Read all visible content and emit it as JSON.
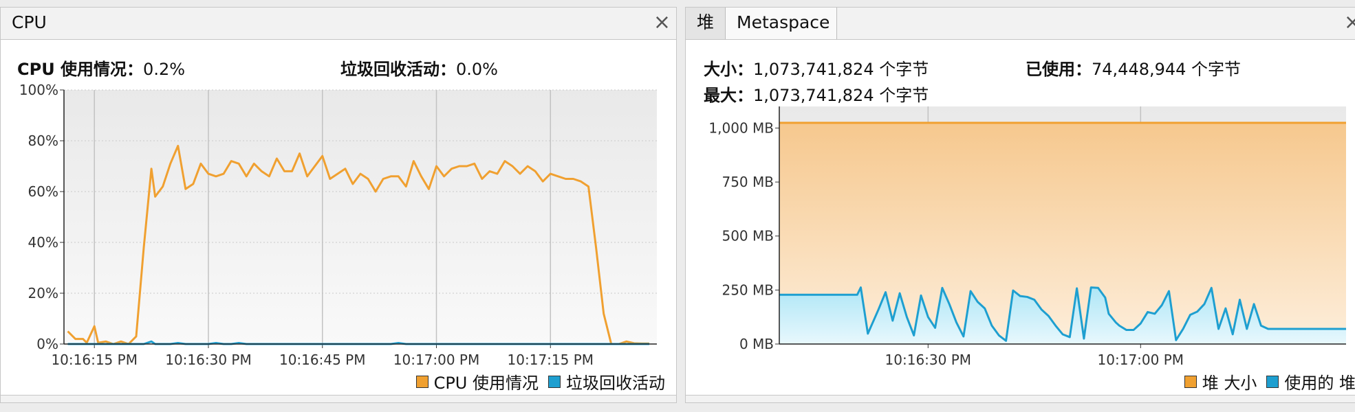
{
  "cpu_panel": {
    "tab_label": "CPU",
    "close_glyph": "×",
    "stats": {
      "cpu_label": "CPU 使用情况：",
      "cpu_value": "0.2%",
      "gc_label": "垃圾回收活动：",
      "gc_value": "0.0%"
    },
    "legend": {
      "cpu": "CPU 使用情况",
      "gc": "垃圾回收活动"
    }
  },
  "heap_panel": {
    "tabs": [
      "堆",
      "Metaspace"
    ],
    "close_glyph": "×",
    "stats": {
      "size_label": "大小：",
      "size_value": "1,073,741,824 个字节",
      "used_label": "已使用：",
      "used_value": "74,448,944 个字节",
      "max_label": "最大：",
      "max_value": "1,073,741,824 个字节"
    },
    "legend": {
      "size": "堆 大小",
      "used": "使用的 堆"
    }
  },
  "colors": {
    "orange": "#f0a030",
    "blue": "#1e9fd0"
  },
  "chart_data": [
    {
      "type": "line",
      "title": "CPU",
      "x": [
        "10:16:11.5",
        "10:16:12.5",
        "10:16:13.5",
        "10:16:14",
        "10:16:15",
        "10:16:15.5",
        "10:16:16.5",
        "10:16:17.5",
        "10:16:18.5",
        "10:16:19.5",
        "10:16:20.5",
        "10:16:21.5",
        "10:16:22.5",
        "10:16:23",
        "10:16:24",
        "10:16:25",
        "10:16:26",
        "10:16:27",
        "10:16:28",
        "10:16:29",
        "10:16:30",
        "10:16:31",
        "10:16:32",
        "10:16:33",
        "10:16:34",
        "10:16:35",
        "10:16:36",
        "10:16:37",
        "10:16:38",
        "10:16:39",
        "10:16:40",
        "10:16:41",
        "10:16:42",
        "10:16:43",
        "10:16:44",
        "10:16:45",
        "10:16:46",
        "10:16:47",
        "10:16:48",
        "10:16:49",
        "10:16:50",
        "10:16:51",
        "10:16:52",
        "10:16:53",
        "10:16:54",
        "10:16:55",
        "10:16:56",
        "10:16:57",
        "10:16:58",
        "10:16:59",
        "10:17:00",
        "10:17:01",
        "10:17:02",
        "10:17:03",
        "10:17:04",
        "10:17:05",
        "10:17:06",
        "10:17:07",
        "10:17:08",
        "10:17:09",
        "10:17:10",
        "10:17:11",
        "10:17:12",
        "10:17:13",
        "10:17:14",
        "10:17:15",
        "10:17:16",
        "10:17:17",
        "10:17:18",
        "10:17:19",
        "10:17:20",
        "10:17:21",
        "10:17:22",
        "10:17:23",
        "10:17:24",
        "10:17:25",
        "10:17:26",
        "10:17:27",
        "10:17:28"
      ],
      "series": [
        {
          "name": "CPU 使用情况",
          "color": "#f0a030",
          "values": [
            5,
            2,
            2,
            0.5,
            7,
            0.5,
            1,
            0,
            1,
            0,
            3,
            38,
            69,
            58,
            62,
            71,
            78,
            61,
            63,
            71,
            67,
            66,
            67,
            72,
            71,
            66,
            71,
            68,
            66,
            73,
            68,
            68,
            75,
            66,
            70,
            74,
            65,
            67,
            69,
            63,
            67,
            65,
            60,
            65,
            66,
            66,
            62,
            72,
            66,
            61,
            70,
            66,
            69,
            70,
            70,
            71,
            65,
            68,
            67,
            72,
            70,
            67,
            70,
            68,
            64,
            67,
            66,
            65,
            65,
            64,
            62,
            38,
            12,
            0,
            0,
            1,
            0.3,
            0.2,
            0.2
          ]
        },
        {
          "name": "垃圾回收活动",
          "color": "#1e9fd0",
          "values": [
            0,
            0,
            0,
            0,
            0,
            0,
            0,
            0,
            0,
            0,
            0,
            0,
            1,
            0,
            0,
            0,
            0.4,
            0,
            0,
            0,
            0,
            0.4,
            0,
            0,
            0.4,
            0,
            0,
            0,
            0,
            0,
            0,
            0,
            0,
            0,
            0,
            0,
            0,
            0,
            0,
            0,
            0,
            0,
            0,
            0,
            0,
            0.4,
            0,
            0,
            0,
            0,
            0,
            0,
            0,
            0,
            0,
            0,
            0,
            0,
            0,
            0,
            0,
            0,
            0,
            0,
            0,
            0,
            0,
            0,
            0,
            0,
            0,
            0,
            0,
            0,
            0,
            0,
            0,
            0,
            0
          ]
        }
      ],
      "x_ticks": [
        "10:16:15 PM",
        "10:16:30 PM",
        "10:16:45 PM",
        "10:17:00 PM",
        "10:17:15 PM"
      ],
      "y_ticks": [
        "0%",
        "20%",
        "40%",
        "60%",
        "80%",
        "100%"
      ],
      "ylim": [
        0,
        100
      ],
      "grid": true,
      "legend": "bottom-right"
    },
    {
      "type": "area",
      "title": "堆",
      "x": [
        "10:16:09",
        "10:16:20",
        "10:16:20.5",
        "10:16:21.5",
        "10:16:23",
        "10:16:24",
        "10:16:25",
        "10:16:26",
        "10:16:27",
        "10:16:28",
        "10:16:29",
        "10:16:30",
        "10:16:31",
        "10:16:32",
        "10:16:33",
        "10:16:34",
        "10:16:35",
        "10:16:36",
        "10:16:37",
        "10:16:38",
        "10:16:39",
        "10:16:40",
        "10:16:41",
        "10:16:42",
        "10:16:43",
        "10:16:44",
        "10:16:45",
        "10:16:46",
        "10:16:47",
        "10:16:48",
        "10:16:49",
        "10:16:50",
        "10:16:51",
        "10:16:52",
        "10:16:53",
        "10:16:54",
        "10:16:55",
        "10:16:55.5",
        "10:16:56.5",
        "10:16:57",
        "10:16:58",
        "10:16:59",
        "10:17:00",
        "10:17:01",
        "10:17:02",
        "10:17:03",
        "10:17:04",
        "10:17:05",
        "10:17:06",
        "10:17:07",
        "10:17:08",
        "10:17:09",
        "10:17:10",
        "10:17:11",
        "10:17:12",
        "10:17:13",
        "10:17:14",
        "10:17:15",
        "10:17:16",
        "10:17:17",
        "10:17:18",
        "10:17:19",
        "10:17:20",
        "10:17:21",
        "10:17:22",
        "10:17:25",
        "10:17:29"
      ],
      "series": [
        {
          "name": "堆 大小",
          "color": "#f0a030",
          "values": [
            1024,
            1024,
            1024,
            1024,
            1024,
            1024,
            1024,
            1024,
            1024,
            1024,
            1024,
            1024,
            1024,
            1024,
            1024,
            1024,
            1024,
            1024,
            1024,
            1024,
            1024,
            1024,
            1024,
            1024,
            1024,
            1024,
            1024,
            1024,
            1024,
            1024,
            1024,
            1024,
            1024,
            1024,
            1024,
            1024,
            1024,
            1024,
            1024,
            1024,
            1024,
            1024,
            1024,
            1024,
            1024,
            1024,
            1024,
            1024,
            1024,
            1024,
            1024,
            1024,
            1024,
            1024,
            1024,
            1024,
            1024,
            1024,
            1024,
            1024,
            1024,
            1024,
            1024,
            1024,
            1024,
            1024,
            1024
          ]
        },
        {
          "name": "使用的 堆",
          "color": "#1e9fd0",
          "values": [
            228,
            228,
            262,
            48,
            160,
            240,
            108,
            235,
            125,
            40,
            225,
            125,
            75,
            260,
            185,
            100,
            35,
            245,
            195,
            165,
            85,
            40,
            15,
            248,
            222,
            218,
            205,
            160,
            130,
            85,
            45,
            32,
            258,
            25,
            262,
            260,
            215,
            140,
            100,
            85,
            65,
            65,
            95,
            148,
            140,
            180,
            245,
            18,
            70,
            135,
            150,
            185,
            260,
            70,
            165,
            45,
            205,
            70,
            185,
            85,
            70,
            70,
            70,
            70,
            70,
            70,
            70
          ]
        }
      ],
      "x_ticks": [
        "10:16:30 PM",
        "10:17:00 PM"
      ],
      "y_ticks": [
        "0 MB",
        "250 MB",
        "500 MB",
        "750 MB",
        "1,000 MB"
      ],
      "ylim": [
        0,
        1100
      ],
      "grid": true,
      "legend": "bottom-right"
    }
  ]
}
